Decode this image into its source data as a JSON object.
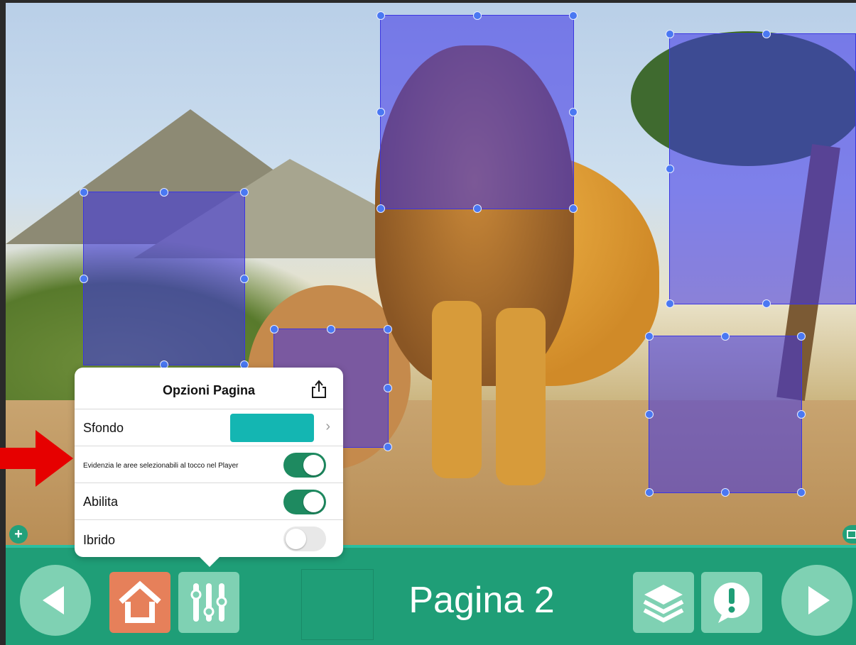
{
  "canvas": {
    "illustration": "savanna-with-lions"
  },
  "popover": {
    "title": "Opzioni Pagina",
    "share_icon": "share-icon",
    "background_row": {
      "label": "Sfondo",
      "color": "#14b6b2"
    },
    "highlight_row": {
      "label": "Evidenzia le aree selezionabili al tocco nel Player",
      "enabled": true
    },
    "enable_row": {
      "label": "Abilita",
      "enabled": true
    },
    "hybrid_row": {
      "label": "Ibrido",
      "enabled": false
    }
  },
  "toolbar": {
    "page_label": "Pagina 2",
    "buttons": [
      "previous-page",
      "home",
      "page-options",
      "layers",
      "alerts",
      "next-page"
    ]
  },
  "colors": {
    "toolbar": "#1f9e77",
    "button_light": "#7fd1b3",
    "home_button": "#e6805a",
    "selection": "#3b36e0",
    "toggle_on": "#1e8a60",
    "annotation_arrow": "#e60000"
  }
}
